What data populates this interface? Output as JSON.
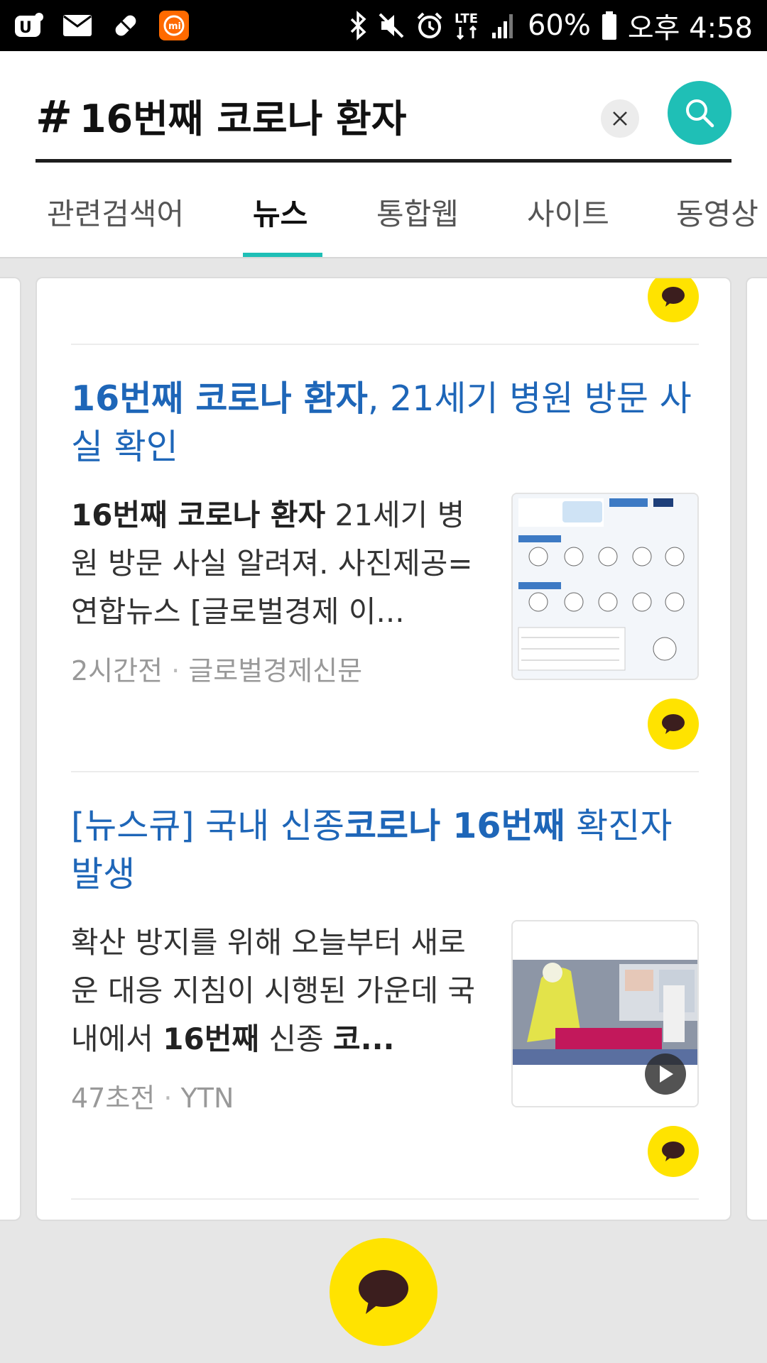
{
  "status_bar": {
    "battery": "60%",
    "time": "오후 4:58",
    "network": "LTE",
    "icons": [
      "app-icon",
      "mail-icon",
      "pill-icon",
      "mi-app-icon",
      "bluetooth-icon",
      "mute-icon",
      "alarm-icon",
      "signal-icon",
      "battery-icon"
    ]
  },
  "search": {
    "query": "16번째 코로나 환자",
    "hash": "#"
  },
  "tabs": [
    "관련검색어",
    "뉴스",
    "통합웹",
    "사이트",
    "동영상"
  ],
  "active_tab": "뉴스",
  "news": [
    {
      "title_bold": "16번째 코로나 환자",
      "title_rest": ", 21세기 병원 방문 사실 확인",
      "body_bold": "16번째 코로나 환자",
      "body_rest": " 21세기 병원 방문 사실 알려져. 사진제공=연합뉴스 [글로벌경제 이...",
      "time": "2시간전",
      "source": "글로벌경제신문",
      "separator": "·"
    },
    {
      "title_a": "[뉴스큐] 국내 신종",
      "title_bold": "코로나 16번째",
      "title_b": " 확진자 발생",
      "body_a": "확산 방지를 위해 오늘부터 새로운 대응 지침이 시행된 가운데 국내에서 ",
      "body_bold": "16번째",
      "body_b": " 신종 ",
      "body_bold2": "코...",
      "time": "47초전",
      "source": "YTN",
      "separator": "·"
    }
  ],
  "colors": {
    "accent": "#1fbfb6",
    "kakao_yellow": "#ffe300",
    "link_blue": "#1e66b8"
  }
}
